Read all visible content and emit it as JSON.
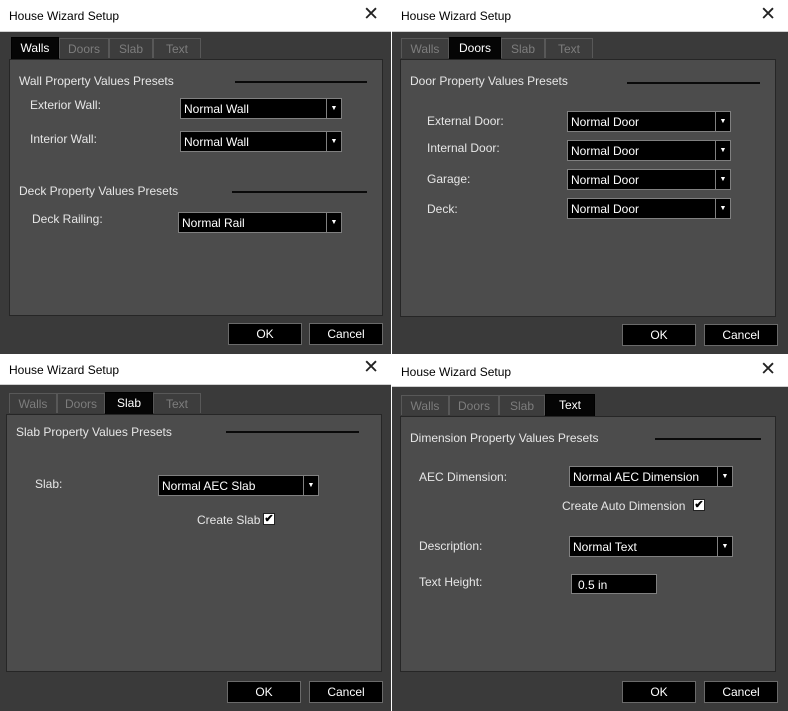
{
  "dialog_title": "House Wizard Setup",
  "close_glyph": "✕",
  "tabs": [
    "Walls",
    "Doors",
    "Slab",
    "Text"
  ],
  "buttons": {
    "ok": "OK",
    "cancel": "Cancel"
  },
  "combo_arrow": "▼",
  "check_glyph": "✔",
  "walls": {
    "wall_section": "Wall Property Values Presets",
    "exterior_label": "Exterior Wall:",
    "exterior_value": "Normal Wall",
    "interior_label": "Interior Wall:",
    "interior_value": "Normal Wall",
    "deck_section": "Deck Property Values Presets",
    "railing_label": "Deck Railing:",
    "railing_value": "Normal Rail"
  },
  "doors": {
    "section": "Door Property Values Presets",
    "rows": [
      {
        "label": "External Door:",
        "value": "Normal Door"
      },
      {
        "label": "Internal Door:",
        "value": "Normal Door"
      },
      {
        "label": "Garage:",
        "value": "Normal Door"
      },
      {
        "label": "Deck:",
        "value": "Normal Door"
      }
    ]
  },
  "slab": {
    "section": "Slab Property Values Presets",
    "slab_label": "Slab:",
    "slab_value": "Normal AEC Slab",
    "create_label": "Create Slab",
    "create_checked": true
  },
  "text": {
    "section": "Dimension Property Values Presets",
    "aec_label": "AEC Dimension:",
    "aec_value": "Normal AEC Dimension",
    "auto_label": "Create Auto Dimension",
    "auto_checked": true,
    "desc_label": "Description:",
    "desc_value": "Normal Text",
    "height_label": "Text Height:",
    "height_value": "0.5 in"
  }
}
